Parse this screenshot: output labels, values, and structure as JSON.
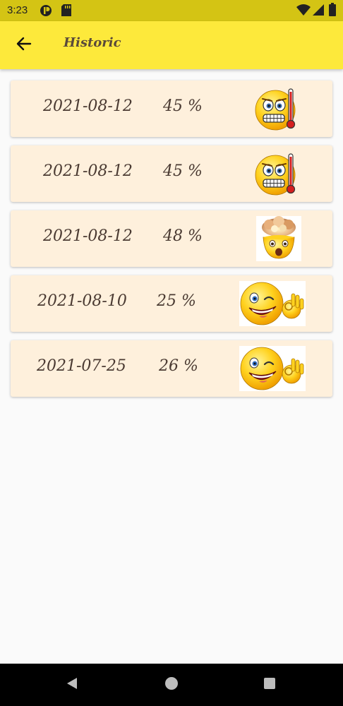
{
  "status_bar": {
    "time": "3:23",
    "icons": [
      "notification-icon",
      "sd-card-icon",
      "wifi-icon",
      "signal-icon",
      "battery-icon"
    ]
  },
  "app_bar": {
    "title": "Historic",
    "back_icon": "arrow-left-icon",
    "background": "#fde93b"
  },
  "records": [
    {
      "date": "2021-08-12",
      "percent": "45 %",
      "mood_icon": "thermometer-face-emoji"
    },
    {
      "date": "2021-08-12",
      "percent": "45 %",
      "mood_icon": "thermometer-face-emoji"
    },
    {
      "date": "2021-08-12",
      "percent": "48 %",
      "mood_icon": "exploding-head-emoji"
    },
    {
      "date": "2021-08-10",
      "percent": "25 %",
      "mood_icon": "winking-ok-emoji"
    },
    {
      "date": "2021-07-25",
      "percent": "26 %",
      "mood_icon": "winking-ok-emoji"
    }
  ],
  "nav_bar": {
    "buttons": [
      "back-triangle-icon",
      "home-circle-icon",
      "recents-square-icon"
    ]
  }
}
